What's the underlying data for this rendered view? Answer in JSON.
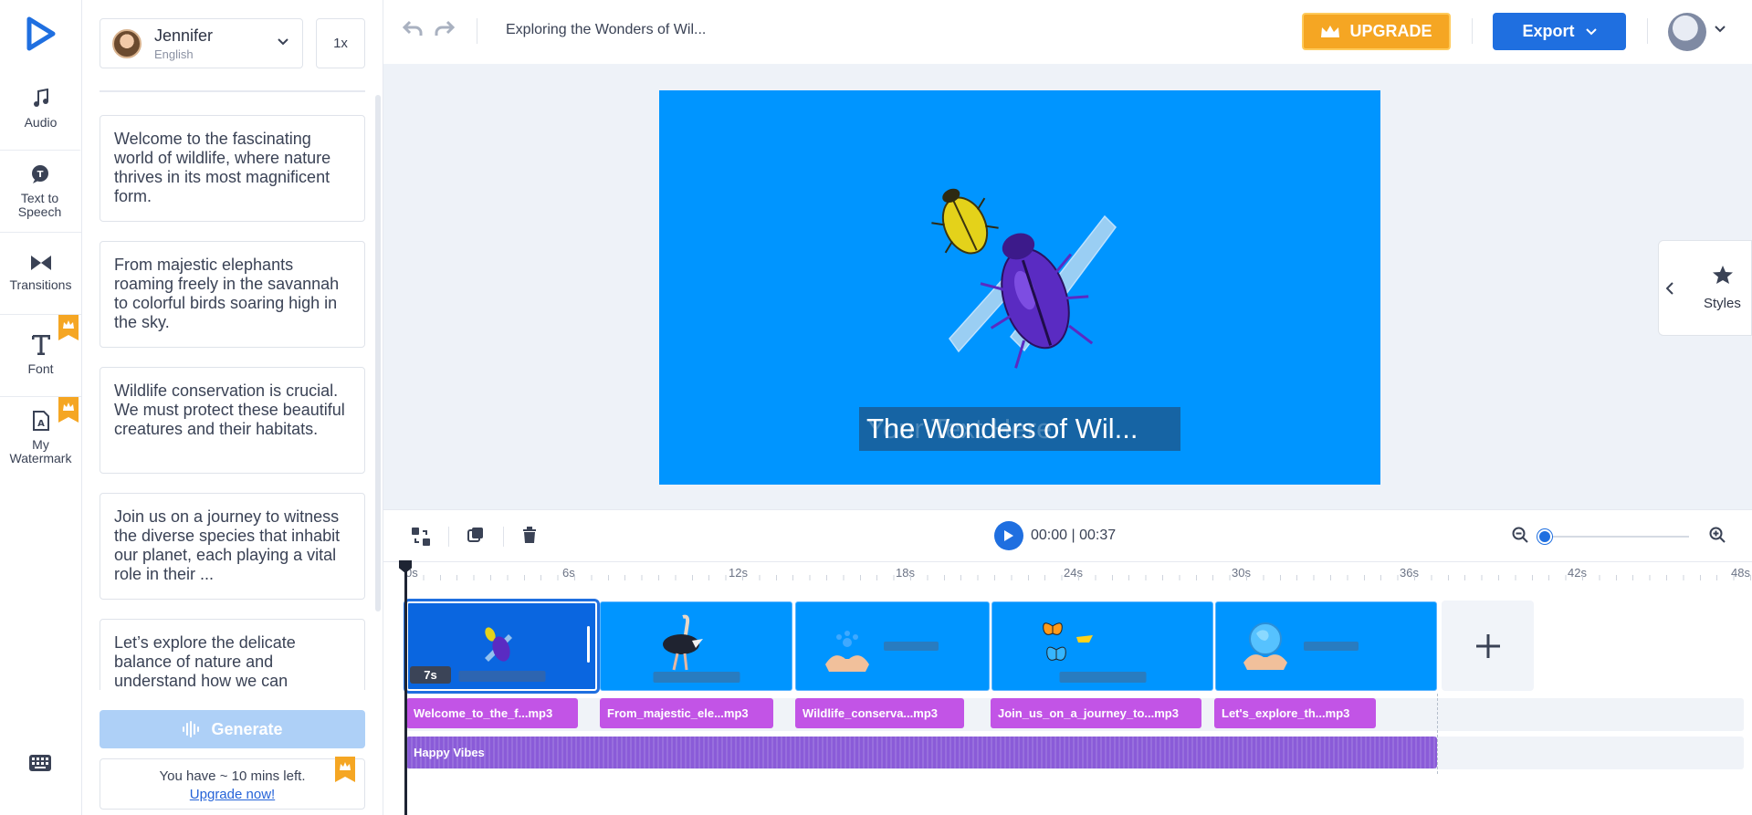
{
  "rail": {
    "items": [
      {
        "label": "Audio"
      },
      {
        "label": "Text to Speech"
      },
      {
        "label": "Transitions"
      },
      {
        "label": "Font"
      },
      {
        "label": "My Watermark"
      }
    ]
  },
  "panel": {
    "voice": {
      "name": "Jennifer",
      "language": "English"
    },
    "speed": "1x",
    "scripts": [
      "Welcome to the fascinating world of wildlife, where nature thrives in its most magnificent form.",
      "From majestic elephants roaming freely in the savannah to colorful birds soaring high in the sky.",
      "Wildlife conservation is crucial. We must protect these beautiful creatures and their habitats.",
      "Join us on a journey to witness the diverse species that inhabit our planet, each playing a vital role in their ...",
      "Let’s explore the delicate balance of nature and understand how we can"
    ],
    "generate_label": "Generate",
    "quota_text": "You have ~ 10 mins left.",
    "upgrade_link": "Upgrade now!"
  },
  "topbar": {
    "project_title": "Exploring the Wonders of Wil...",
    "upgrade_label": "UPGRADE",
    "export_label": "Export"
  },
  "preview": {
    "caption_placeholder": "Your Text Here",
    "caption_text": "The Wonders of Wil..."
  },
  "styles_panel": {
    "label": "Styles"
  },
  "timeline": {
    "time_display": "00:00 | 00:37",
    "ticks": [
      "0s",
      "6s",
      "12s",
      "18s",
      "24s",
      "30s",
      "36s",
      "42s",
      "48s"
    ],
    "first_clip_duration": "7s",
    "clip_placeholder": "Your Text Here",
    "audio_clips": [
      "Welcome_to_the_f...mp3",
      "From_majestic_ele...mp3",
      "Wildlife_conserva...mp3",
      "Join_us_on_a_journey_to...mp3",
      "Let's_explore_th...mp3"
    ],
    "music_track": "Happy Vibes"
  },
  "colors": {
    "accent_blue": "#1f6fe0",
    "canvas_blue": "#0095ff",
    "upgrade_orange": "#f5a623",
    "audio_purple": "#c254e6",
    "music_purple": "#8a5bd8"
  }
}
